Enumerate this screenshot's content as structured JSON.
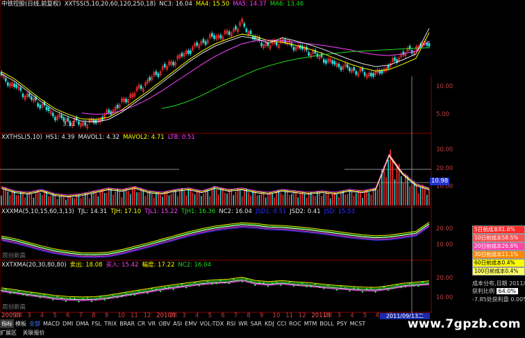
{
  "panels": {
    "price": {
      "header": [
        {
          "text": "中铁控股(日线,前复权)",
          "color": "#e8e8e8"
        },
        {
          "text": "XXTSS(5,10,20,60,120,250,18)",
          "color": "#e8e8e8"
        },
        {
          "text": "NC3: 16.04",
          "color": "#e8e8e8"
        },
        {
          "text": "MA4: 15.50",
          "color": "#ffff00"
        },
        {
          "text": "MA5: 14.37",
          "color": "#ff44ff"
        },
        {
          "text": "MA6: 13.46",
          "color": "#22dd22"
        }
      ],
      "low_label": "3.11",
      "y_ticks": [
        "10.00",
        "5.00"
      ]
    },
    "volume": {
      "header": [
        {
          "text": "XXTHSL(5,10)",
          "color": "#e8e8e8"
        },
        {
          "text": "HS1: 4.39",
          "color": "#e8e8e8"
        },
        {
          "text": "MAVOL1: 4.32",
          "color": "#e8e8e8"
        },
        {
          "text": "MAVOL2: 4.71",
          "color": "#ffff00"
        },
        {
          "text": "LTB: 0.51",
          "color": "#ff44ff"
        }
      ],
      "y_ticks": [
        "30.00",
        "20.00",
        "10.00"
      ],
      "marker": "10.98"
    },
    "ma3": {
      "header": [
        {
          "text": "XXXMA(5,10,15,60,3,13)",
          "color": "#e8e8e8"
        },
        {
          "text": "TJL: 14.31",
          "color": "#e8e8e8"
        },
        {
          "text": "TJH: 17.10",
          "color": "#ffff00"
        },
        {
          "text": "TJL1: 15.22",
          "color": "#ff44ff"
        },
        {
          "text": "TJH1: 16.36",
          "color": "#22dd22"
        },
        {
          "text": "NC2: 16.04",
          "color": "#e8e8e8"
        },
        {
          "text": "JSD1: 0.51",
          "color": "#3333ff"
        },
        {
          "text": "JSD2: 0.41",
          "color": "#e8e8e8"
        },
        {
          "text": "JSD: 15.53",
          "color": "#3333ff"
        }
      ],
      "side_label": "周创新高",
      "y_ticks": [
        "20.00",
        "10.00"
      ]
    },
    "ma4": {
      "header": [
        {
          "text": "XXTXMA(20,30,80,80)",
          "color": "#e8e8e8"
        },
        {
          "text": "卖出: 18.08",
          "color": "#ffff00"
        },
        {
          "text": "买入: 15.42",
          "color": "#ff44ff"
        },
        {
          "text": "幅度: 17.22",
          "color": "#ffff00"
        },
        {
          "text": "NC2: 16.04",
          "color": "#22dd22"
        }
      ],
      "side_label": "周创新高",
      "y_ticks": [
        "20.00",
        "10.00"
      ]
    }
  },
  "x_axis": {
    "labels": [
      "2009年",
      "2",
      "3",
      "4",
      "5",
      "6",
      "7",
      "8",
      "9",
      "10",
      "11",
      "12",
      "2010年",
      "2",
      "3",
      "4",
      "5",
      "6",
      "7",
      "8",
      "9",
      "10",
      "11",
      "12",
      "2011年",
      "2",
      "3",
      "4",
      "5",
      "6",
      "7",
      "8",
      "9"
    ],
    "selected_date": "2011/09/13二"
  },
  "cost_legend": [
    {
      "label": "5日前成本81.6%",
      "bg": "#ff2a2a",
      "fg": "#ffffff"
    },
    {
      "label": "10日前成本58.5%",
      "bg": "#ff5050",
      "fg": "#ffffff"
    },
    {
      "label": "20日前成本26.6%",
      "bg": "#ff44aa",
      "fg": "#ffffff"
    },
    {
      "label": "30日前成本11.1%",
      "bg": "#ff8800",
      "fg": "#ffffff"
    },
    {
      "label": "60日前成本0.4%",
      "bg": "#ffff00",
      "fg": "#000000"
    },
    {
      "label": "100日前成本0.4%",
      "bg": "#ffff66",
      "fg": "#000000"
    }
  ],
  "cost_info": {
    "dist_label": "成本分布,日期",
    "dist_date": "2011/09/13",
    "profit_label": "获利比例",
    "profit_value": "64.0%",
    "pnl_label": "-7.85处获利盘",
    "pnl_value": "0.00%"
  },
  "bottom_bar": {
    "tabs": [
      "指标",
      "模板",
      "全部",
      "MACD",
      "DMI",
      "DMA",
      "FSL",
      "TRIX",
      "BRAR",
      "CR",
      "VR",
      "OBV",
      "ASI",
      "EMV",
      "VOL-TDX",
      "RSI",
      "WR",
      "SAR",
      "KDJ",
      "CCI",
      "ROC",
      "MTM",
      "BOLL",
      "PSY",
      "MCST"
    ],
    "sub": [
      "扩展区",
      "关联报价"
    ]
  },
  "watermark": "www.7gpzb.com",
  "chart_data": {
    "type": "line",
    "title": "中铁控股(日线,前复权)",
    "x": [
      "2009年",
      "2",
      "3",
      "4",
      "5",
      "6",
      "7",
      "8",
      "9",
      "10",
      "11",
      "12",
      "2010年",
      "2",
      "3",
      "4",
      "5",
      "6",
      "7",
      "8",
      "9",
      "10",
      "11",
      "12",
      "2011年",
      "2",
      "3",
      "4",
      "5",
      "6",
      "7",
      "8",
      "9"
    ],
    "series": [
      {
        "name": "price",
        "values": [
          9.5,
          8.2,
          6.8,
          5.6,
          4.2,
          3.5,
          3.2,
          3.4,
          4.5,
          6.0,
          7.5,
          9.0,
          10.5,
          11.8,
          13.0,
          14.2,
          15.0,
          15.4,
          16.8,
          14.5,
          13.8,
          14.5,
          13.6,
          13.0,
          12.0,
          11.2,
          10.6,
          10.0,
          9.8,
          11.0,
          12.6,
          13.4,
          14.2
        ]
      },
      {
        "name": "MA4",
        "values": [
          10.2,
          9.2,
          7.8,
          6.4,
          5.2,
          4.4,
          3.8,
          3.7,
          4.0,
          5.0,
          6.3,
          7.6,
          9.0,
          10.4,
          11.8,
          13.0,
          14.0,
          14.7,
          15.3,
          15.0,
          14.4,
          14.2,
          13.8,
          13.3,
          12.7,
          12.0,
          11.3,
          10.7,
          10.3,
          10.5,
          11.2,
          12.0,
          15.5
        ]
      },
      {
        "name": "MA5",
        "values": [
          null,
          null,
          null,
          null,
          null,
          null,
          4.6,
          4.4,
          4.5,
          4.9,
          5.6,
          6.5,
          7.6,
          8.8,
          10.0,
          11.2,
          12.3,
          13.2,
          14.0,
          14.4,
          14.5,
          14.4,
          14.2,
          14.0,
          13.8,
          13.5,
          13.2,
          12.8,
          12.5,
          12.4,
          12.6,
          13.0,
          14.37
        ]
      },
      {
        "name": "MA6",
        "values": [
          null,
          null,
          null,
          null,
          null,
          null,
          null,
          null,
          null,
          null,
          null,
          null,
          5.2,
          5.6,
          6.2,
          7.0,
          7.9,
          8.8,
          9.6,
          10.4,
          11.0,
          11.5,
          11.9,
          12.2,
          12.5,
          12.7,
          12.9,
          13.0,
          13.1,
          13.2,
          13.3,
          13.4,
          13.46
        ]
      }
    ],
    "volume": [
      12,
      9,
      8,
      10,
      7,
      6,
      7,
      9,
      11,
      10,
      12,
      9,
      8,
      10,
      11,
      9,
      12,
      10,
      11,
      9,
      8,
      10,
      9,
      8,
      9,
      8,
      10,
      9,
      11,
      35,
      22,
      14,
      10.98
    ],
    "y_ticks_price": [
      "10.00",
      "5.00"
    ],
    "y_ticks_volume": [
      "30.00",
      "20.00",
      "10.00"
    ]
  }
}
